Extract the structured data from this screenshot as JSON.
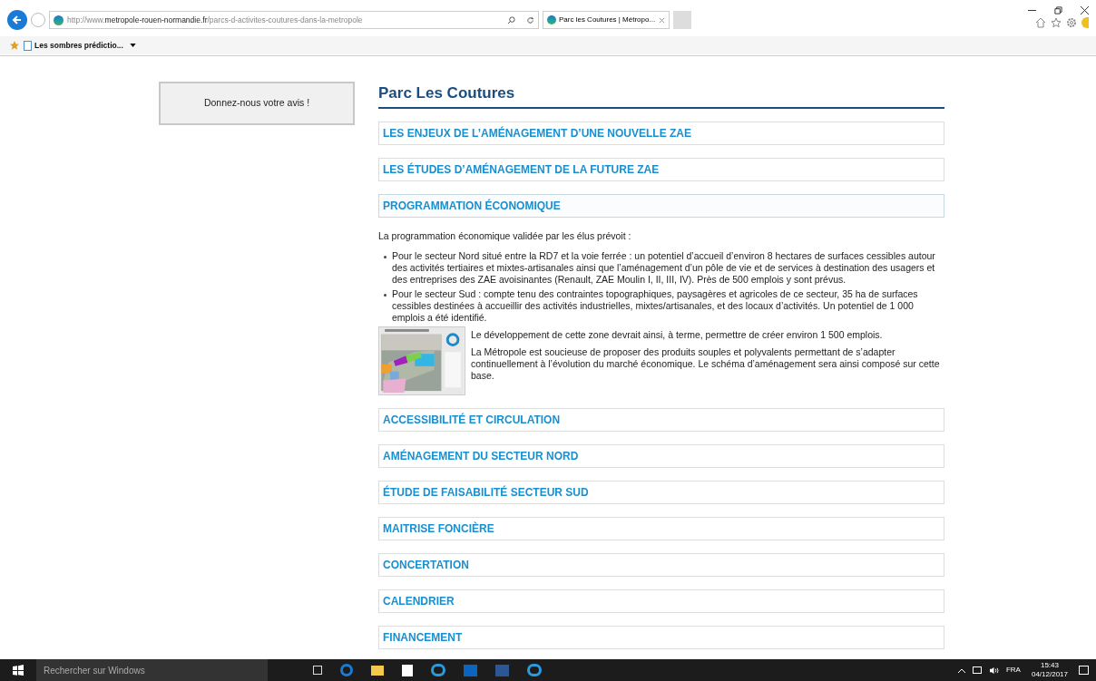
{
  "browser": {
    "url": "http://www.**metropole-rouen-normandie.fr**/parcs-d-activites-coutures-dans-la-metropole",
    "tabs": [
      {
        "title": "Parc les Coutures | Métropo...",
        "selected": true
      }
    ],
    "favorites": [
      {
        "label": "Les sombres prédictio..."
      }
    ]
  },
  "sidebar": {
    "button": "Donnez-nous votre avis !"
  },
  "page": {
    "title": "Parc Les Coutures",
    "sections": [
      {
        "title": "LES ENJEUX DE L’AMÉNAGEMENT D’UNE NOUVELLE ZAE",
        "expanded": false
      },
      {
        "title": "LES ÉTUDES D’AMÉNAGEMENT DE LA FUTURE ZAE",
        "expanded": false
      },
      {
        "title": "PROGRAMMATION ÉCONOMIQUE",
        "expanded": true,
        "intro": "La programmation économique validée par les élus prévoit :",
        "bullets": [
          "Pour le secteur Nord situé entre la RD7 et la voie ferrée : un potentiel d’accueil d’environ 8 hectares de surfaces cessibles autour des activités tertiaires et mixtes-artisanales ainsi que l’aménagement d’un pôle de vie et de services à destination des usagers et des entreprises des ZAE avoisinantes (Renault, ZAE Moulin I, II, III, IV). Près de 500 emplois y sont prévus.",
          "Pour le secteur Sud : compte tenu des contraintes topographiques, paysagères et agricoles de ce secteur, 35 ha de surfaces cessibles destinées à accueillir des activités industrielles, mixtes/artisanales, et des locaux d’activités. Un potentiel de 1 000 emplois a été identifié."
        ],
        "figure_paragraphs": [
          "Le développement de cette zone devrait ainsi, à terme, permettre de créer environ 1 500 emplois.",
          "La Métropole est soucieuse de proposer des produits souples et polyvalents permettant de s’adapter continuellement à l’évolution du marché économique. Le schéma d’aménagement sera ainsi composé sur cette base."
        ]
      },
      {
        "title": "ACCESSIBILITÉ ET CIRCULATION",
        "expanded": false
      },
      {
        "title": "AMÉNAGEMENT DU SECTEUR NORD",
        "expanded": false
      },
      {
        "title": "ÉTUDE DE FAISABILITÉ SECTEUR SUD",
        "expanded": false
      },
      {
        "title": "MAITRISE FONCIÈRE",
        "expanded": false
      },
      {
        "title": "CONCERTATION",
        "expanded": false
      },
      {
        "title": "CALENDRIER",
        "expanded": false
      },
      {
        "title": "FINANCEMENT",
        "expanded": false
      }
    ]
  },
  "taskbar": {
    "search_placeholder": "Rechercher sur Windows",
    "language": "FRA",
    "time": "15:43",
    "date": "04/12/2017"
  }
}
